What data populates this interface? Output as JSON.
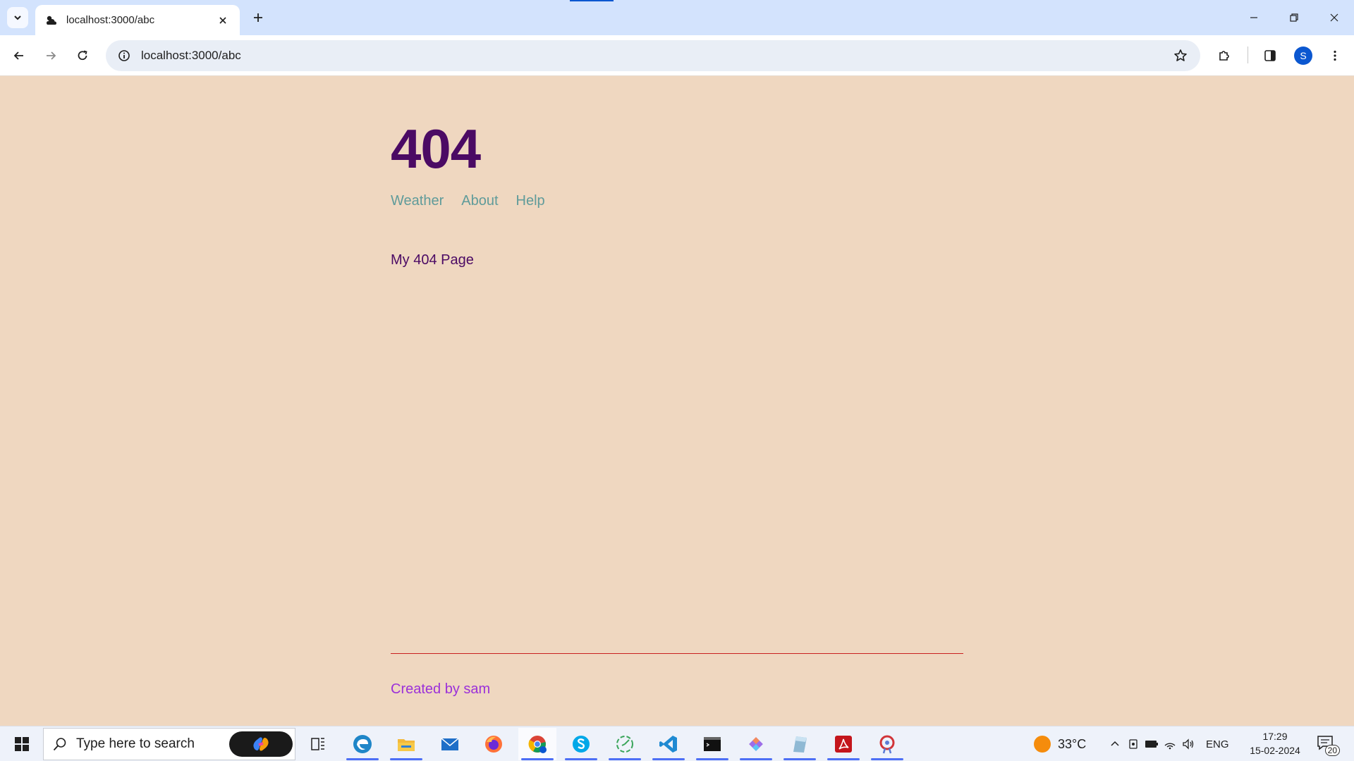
{
  "browser": {
    "tab_title": "localhost:3000/abc",
    "url": "localhost:3000/abc",
    "profile_initial": "S"
  },
  "page": {
    "title": "404",
    "nav": [
      "Weather",
      "About",
      "Help"
    ],
    "message": "My 404 Page",
    "footer": "Created by sam"
  },
  "taskbar": {
    "search_placeholder": "Type here to search",
    "apps": [
      "edge-icon",
      "file-explorer-icon",
      "mail-icon",
      "firefox-icon",
      "chrome-icon",
      "skype-icon",
      "clock-app-icon",
      "vscode-icon",
      "terminal-icon",
      "git-icon",
      "paper-icon",
      "acrobat-icon",
      "settings-app-icon"
    ],
    "temperature": "33°C",
    "language": "ENG",
    "time": "17:29",
    "date": "15-02-2024",
    "notification_count": "20"
  },
  "colors": {
    "page_background": "#efd7c0",
    "title": "#4b0a64",
    "nav_link": "#5f9b9a",
    "footer_text": "#9b30d9",
    "footer_rule": "#c81e1e",
    "tabstrip": "#d3e3fd"
  }
}
